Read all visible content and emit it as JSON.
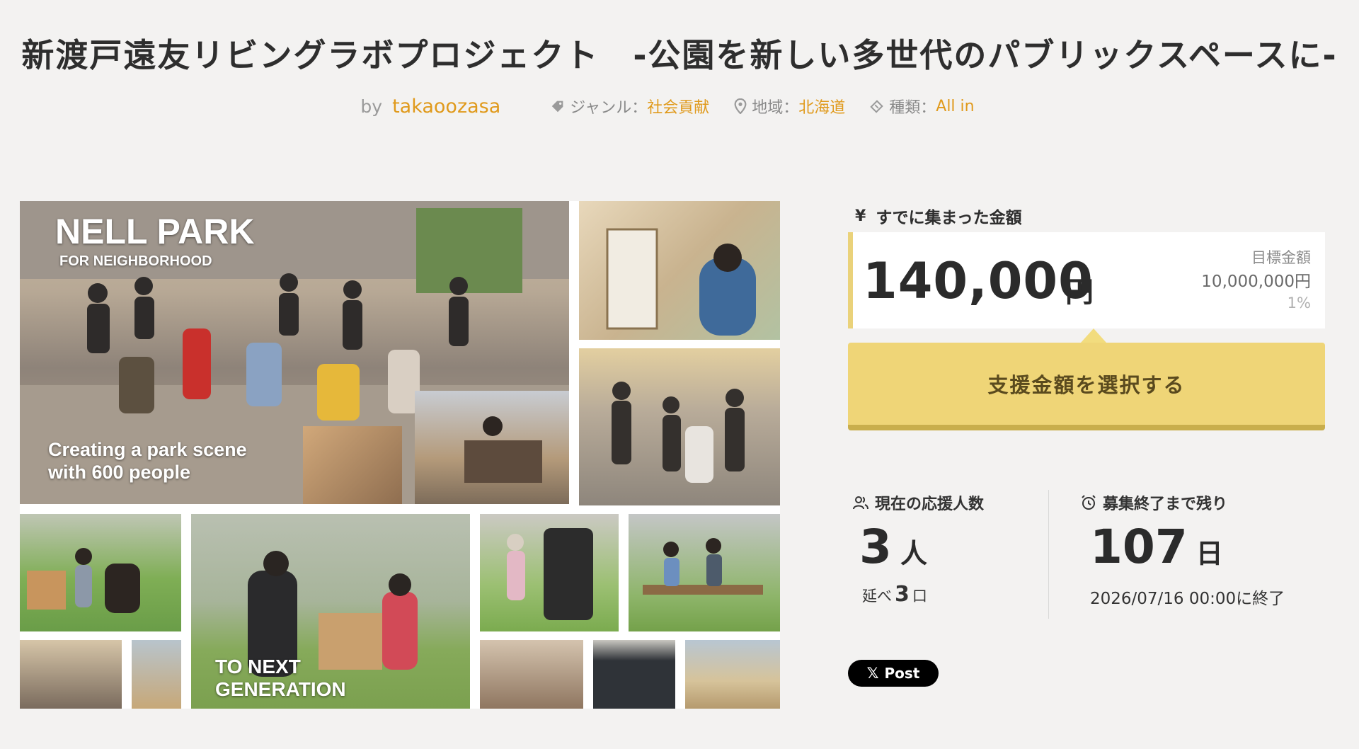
{
  "project": {
    "title": "新渡戸遠友リビングラボプロジェクト　-公園を新しい多世代のパブリックスペースに-",
    "by_label": "by",
    "author": "takaoozasa",
    "genre_label": "ジャンル：",
    "genre": "社会貢献",
    "region_label": "地域：",
    "region": "北海道",
    "type_label": "種類：",
    "type": "All in"
  },
  "collage": {
    "caption_nell": "NELL PARK",
    "caption_for": "FOR NEIGHBORHOOD",
    "caption_creating_1": "Creating a park scene",
    "caption_creating_2": "with 600 people",
    "caption_next_1": "TO NEXT",
    "caption_next_2": "GENERATION"
  },
  "funding": {
    "raised_label": "すでに集まった金額",
    "yen_symbol": "¥",
    "amount": "140,000",
    "amount_unit": "円",
    "goal_label": "目標金額",
    "goal_amount": "10,000,000円",
    "percent": "1%",
    "support_button": "支援金額を選択する"
  },
  "supporters": {
    "label": "現在の応援人数",
    "count": "3",
    "unit": "人",
    "total_label": "延べ",
    "total_count": "3",
    "total_unit": "口"
  },
  "remaining": {
    "label": "募集終了まで残り",
    "days": "107",
    "unit": "日",
    "end_text": "2026/07/16 00:00に終了"
  },
  "share": {
    "x_symbol": "𝕏",
    "post_label": "Post"
  },
  "colors": {
    "accent": "#e09a1c",
    "button": "#efd577",
    "background": "#f3f2f1"
  }
}
